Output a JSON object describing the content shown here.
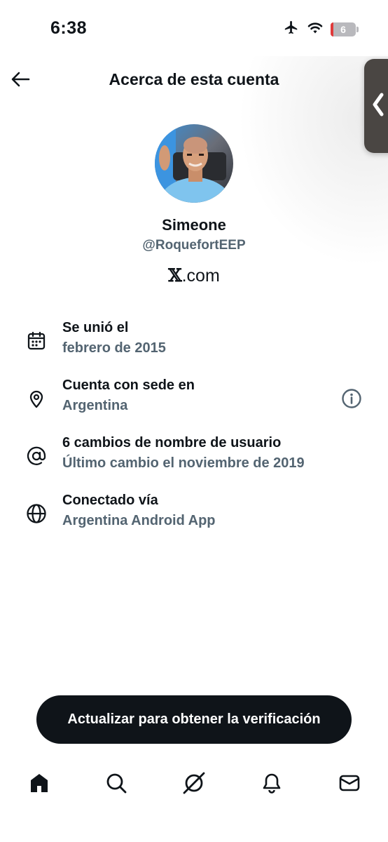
{
  "status_bar": {
    "time": "6:38",
    "battery_level": "6"
  },
  "header": {
    "title": "Acerca de esta cuenta"
  },
  "profile": {
    "name": "Simeone",
    "handle": "@RoquefortEEP",
    "site_x": "𝕏",
    "site_domain": ".com"
  },
  "info": [
    {
      "icon": "calendar-icon",
      "title": "Se unió el",
      "value": "febrero de 2015"
    },
    {
      "icon": "location-pin-icon",
      "title": "Cuenta con sede en",
      "value": "Argentina",
      "extra_icon": "info-circle-icon"
    },
    {
      "icon": "at-sign-icon",
      "title": "6 cambios de nombre de usuario",
      "value": "Último cambio el noviembre de 2019"
    },
    {
      "icon": "globe-icon",
      "title": "Conectado vía",
      "value": "Argentina Android App"
    }
  ],
  "verify_button": {
    "label": "Actualizar para obtener la verificación"
  },
  "tab_bar": [
    {
      "name": "home-icon"
    },
    {
      "name": "search-icon"
    },
    {
      "name": "grok-icon"
    },
    {
      "name": "notifications-bell-icon"
    },
    {
      "name": "messages-envelope-icon"
    }
  ]
}
